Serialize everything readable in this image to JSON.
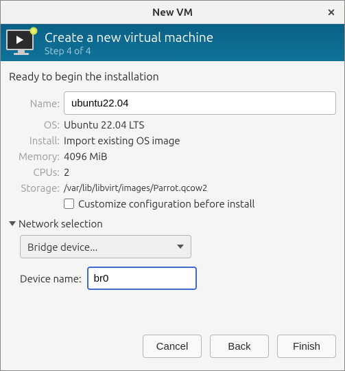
{
  "window": {
    "title": "New VM"
  },
  "header": {
    "title": "Create a new virtual machine",
    "subtitle": "Step 4 of 4"
  },
  "ready_text": "Ready to begin the installation",
  "labels": {
    "name": "Name:",
    "os": "OS:",
    "install": "Install:",
    "memory": "Memory:",
    "cpus": "CPUs:",
    "storage": "Storage:",
    "customize": "Customize configuration before install",
    "network_section": "Network selection",
    "device_name": "Device name:"
  },
  "values": {
    "name": "ubuntu22.04",
    "os": "Ubuntu 22.04 LTS",
    "install": "Import existing OS image",
    "memory": "4096 MiB",
    "cpus": "2",
    "storage": "/var/lib/libvirt/images/Parrot.qcow2",
    "network_device_type": "Bridge device...",
    "device_name": "br0"
  },
  "buttons": {
    "cancel": "Cancel",
    "back": "Back",
    "finish": "Finish"
  }
}
